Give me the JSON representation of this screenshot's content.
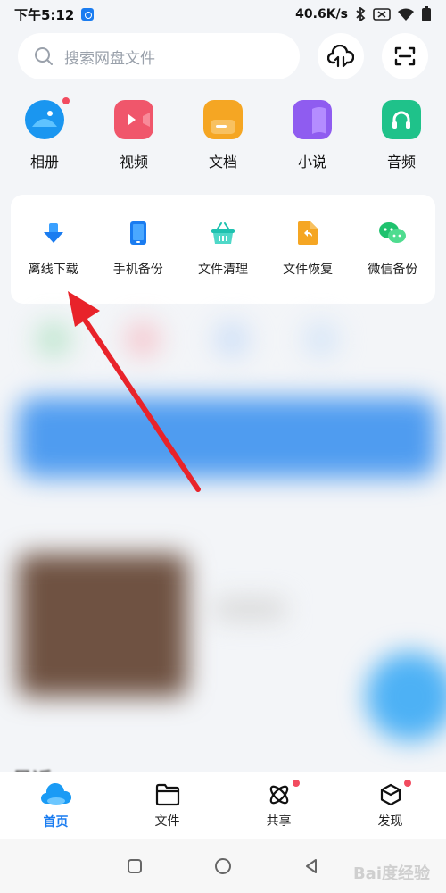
{
  "status": {
    "time": "下午5:12",
    "speed": "40.6K/s"
  },
  "search": {
    "placeholder": "搜索网盘文件"
  },
  "categories": [
    {
      "label": "相册",
      "icon": "photo-album-icon",
      "color": "#1a96f0"
    },
    {
      "label": "视频",
      "icon": "video-icon",
      "color": "#f0566b"
    },
    {
      "label": "文档",
      "icon": "document-icon",
      "color": "#f5a623"
    },
    {
      "label": "小说",
      "icon": "book-icon",
      "color": "#8f5cf0"
    },
    {
      "label": "音频",
      "icon": "headphones-icon",
      "color": "#1fc28a"
    }
  ],
  "tools": [
    {
      "label": "离线下载",
      "icon": "download-arrow-icon",
      "color": "#1a7cf0"
    },
    {
      "label": "手机备份",
      "icon": "phone-icon",
      "color": "#1a7cf0"
    },
    {
      "label": "文件清理",
      "icon": "basket-icon",
      "color": "#1fc2b0"
    },
    {
      "label": "文件恢复",
      "icon": "restore-file-icon",
      "color": "#f5a623"
    },
    {
      "label": "微信备份",
      "icon": "wechat-icon",
      "color": "#1fc26e"
    }
  ],
  "recent": {
    "title": "最近"
  },
  "nav": [
    {
      "label": "首页",
      "icon": "cloud-home-icon"
    },
    {
      "label": "文件",
      "icon": "folder-icon"
    },
    {
      "label": "共享",
      "icon": "share-atom-icon"
    },
    {
      "label": "发现",
      "icon": "discover-icon"
    }
  ],
  "watermark": "Bai度经验"
}
